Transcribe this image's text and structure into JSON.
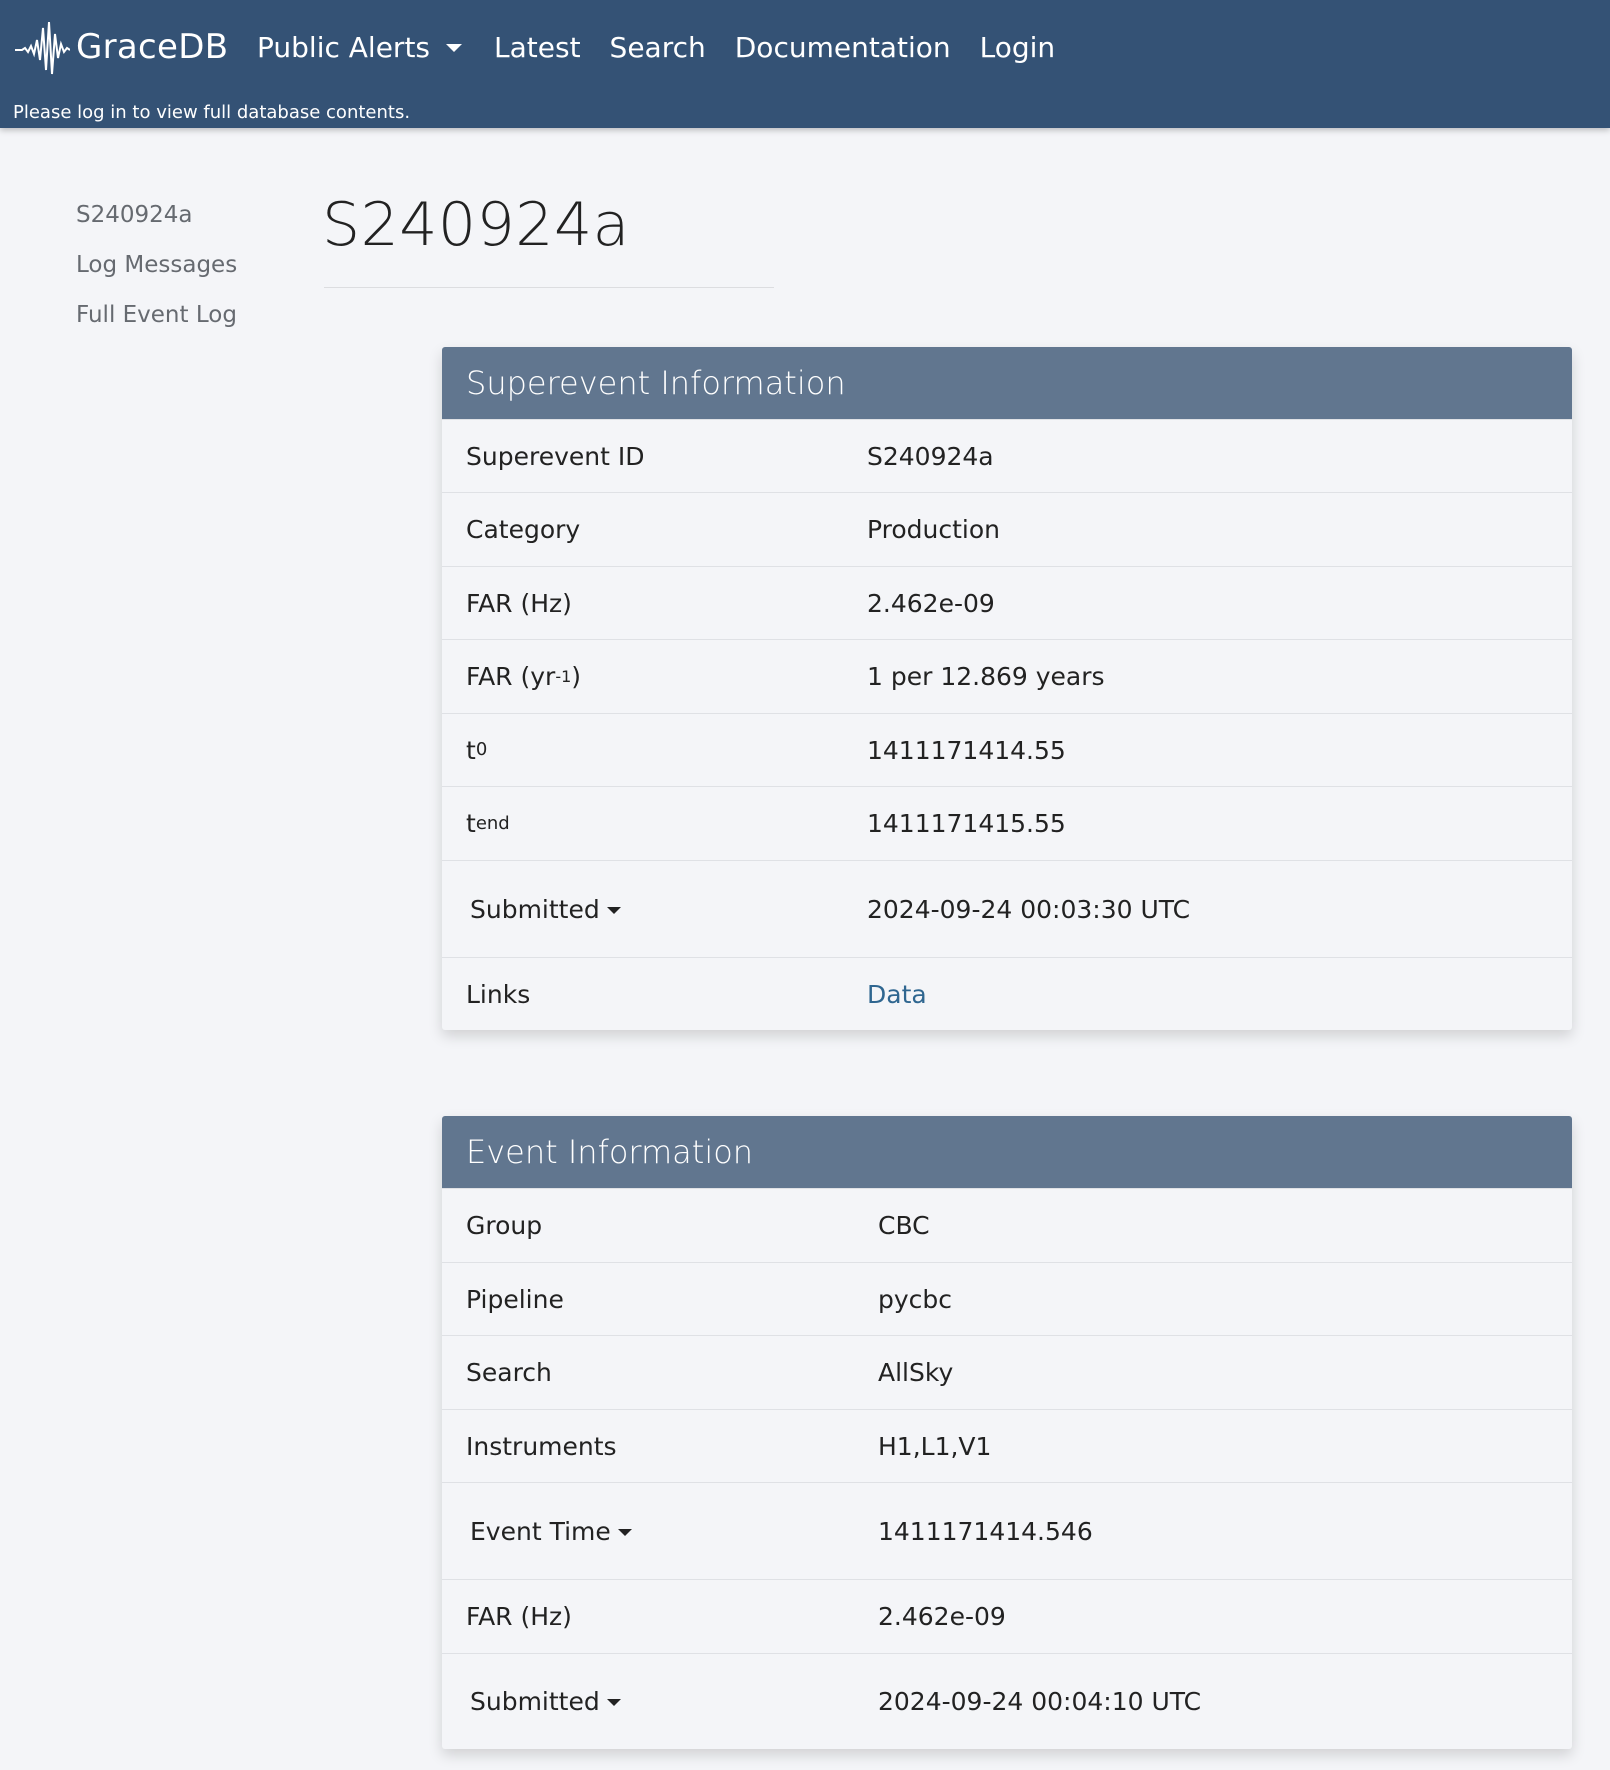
{
  "navbar": {
    "brand": "GraceDB",
    "public_alerts": "Public Alerts",
    "latest": "Latest",
    "search": "Search",
    "documentation": "Documentation",
    "login": "Login",
    "note": "Please log in to view full database contents."
  },
  "sidebar": {
    "items": [
      "S240924a",
      "Log Messages",
      "Full Event Log"
    ]
  },
  "page": {
    "title": "S240924a"
  },
  "superevent": {
    "header": "Superevent Information",
    "rows": {
      "id_label": "Superevent ID",
      "id_value": "S240924a",
      "category_label": "Category",
      "category_value": "Production",
      "far_hz_label": "FAR (Hz)",
      "far_hz_value": "2.462e-09",
      "far_yr_label": "FAR (yr",
      "far_yr_sup": "-1",
      "far_yr_close": ")",
      "far_yr_value": "1 per 12.869 years",
      "t0_label": "t",
      "t0_sub": "0",
      "t0_value": "1411171414.55",
      "tend_label": "t",
      "tend_sub": "end",
      "tend_value": "1411171415.55",
      "submitted_label": "Submitted",
      "submitted_value": "2024-09-24 00:03:30 UTC",
      "links_label": "Links",
      "links_value": "Data"
    }
  },
  "event": {
    "header": "Event Information",
    "rows": {
      "group_label": "Group",
      "group_value": "CBC",
      "pipeline_label": "Pipeline",
      "pipeline_value": "pycbc",
      "search_label": "Search",
      "search_value": "AllSky",
      "instruments_label": "Instruments",
      "instruments_value": "H1,L1,V1",
      "event_time_label": "Event Time",
      "event_time_value": "1411171414.546",
      "far_label": "FAR (Hz)",
      "far_value": "2.462e-09",
      "submitted_label": "Submitted",
      "submitted_value": "2024-09-24 00:04:10 UTC"
    }
  },
  "colors": {
    "navbar": "#345275",
    "card_header": "#61768f",
    "link": "#2f6690",
    "background": "#f4f5f8"
  }
}
